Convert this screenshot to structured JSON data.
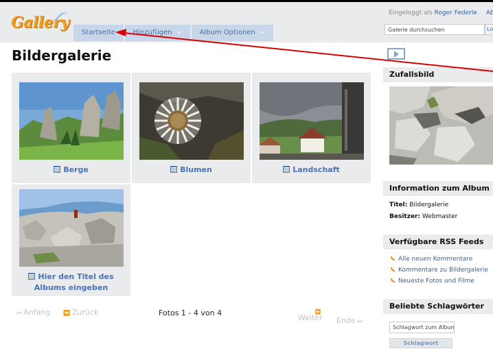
{
  "header": {
    "logo_text": "Gallery",
    "nav": [
      {
        "label": "Startseite",
        "has_caret": false
      },
      {
        "label": "Hinzufügen",
        "has_caret": true
      },
      {
        "label": "Album Optionen",
        "has_caret": true
      }
    ],
    "login_prefix": "Eingeloggt als",
    "user_name": "Roger Federle",
    "logout_label": "Abmelden",
    "search_placeholder": "Galerie durchsuchen",
    "search_button": "Login"
  },
  "main": {
    "title": "Bildergalerie",
    "albums": [
      {
        "title": "Berge",
        "photo": "mountain-meadow"
      },
      {
        "title": "Blumen",
        "photo": "thistle-flower"
      },
      {
        "title": "Landschaft",
        "photo": "village-landscape"
      },
      {
        "title": "Hier den Titel des Albums eingeben",
        "photo": "rocky-karst"
      }
    ],
    "pager": {
      "first": "Anfang",
      "prev": "Zurück",
      "status": "Fotos 1 - 4 von 4",
      "next": "Weiter",
      "last": "Ende"
    }
  },
  "sidebar": {
    "slideshow_icon": "slideshow-icon",
    "random_title": "Zufallsbild",
    "album_info_title": "Information zum Album",
    "info_title_label": "Titel:",
    "info_title_value": "Bildergalerie",
    "info_owner_label": "Besitzer:",
    "info_owner_value": "Webmaster",
    "rss_title": "Verfügbare RSS Feeds",
    "rss_links": [
      "Alle neuen Kommentare",
      "Kommentare zu Bildergalerie",
      "Neueste Fotos und Filme"
    ],
    "tags_title": "Beliebte Schlagwörter",
    "tag_input_placeholder": "Schlagwort zum Album",
    "tag_button": "Schlagwort hinzufügen"
  },
  "colors": {
    "header_bg": "#e9ebed",
    "nav_bg": "#c8d6ea",
    "link_blue": "#4a72b8",
    "annotation_red": "#d80000",
    "logo_orange": "#f0a020"
  }
}
